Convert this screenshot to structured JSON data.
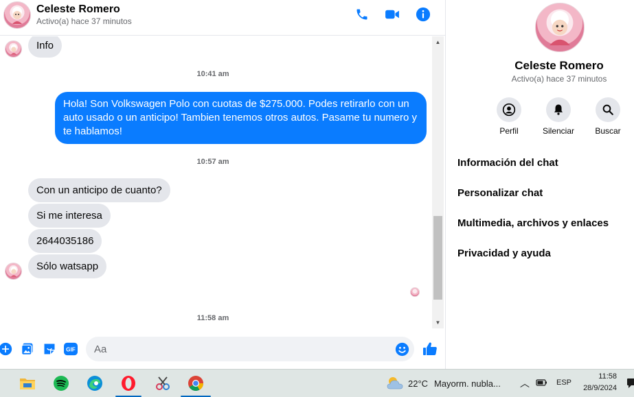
{
  "chat": {
    "contact_name": "Celeste Romero",
    "contact_status": "Activo(a) hace 37 minutos",
    "messages": {
      "info": "Info",
      "ts1": "10:41 am",
      "outgoing": "Hola! Son Volkswagen Polo con cuotas de $275.000. Podes retirarlo con un auto usado o un anticipo! Tambien tenemos otros autos. Pasame tu numero y te hablamos!",
      "ts2": "10:57 am",
      "in1": "Con un anticipo de cuanto?",
      "in2": "Si me interesa",
      "in3": "2644035186",
      "in4": "Sólo watsapp",
      "ts3": "11:58 am"
    },
    "composer": {
      "placeholder": "Aa"
    }
  },
  "details": {
    "name": "Celeste Romero",
    "status": "Activo(a) hace 37 minutos",
    "actions": {
      "profile": "Perfil",
      "mute": "Silenciar",
      "search": "Buscar"
    },
    "menu": {
      "chat_info": "Información del chat",
      "customize": "Personalizar chat",
      "media": "Multimedia, archivos y enlaces",
      "privacy": "Privacidad y ayuda"
    }
  },
  "taskbar": {
    "weather_temp": "22°C",
    "weather_desc": "Mayorm. nubla...",
    "lang": "ESP",
    "time": "11:58",
    "date": "28/9/2024"
  },
  "colors": {
    "accent": "#0a7cff",
    "bubble_in": "#e4e6eb"
  }
}
